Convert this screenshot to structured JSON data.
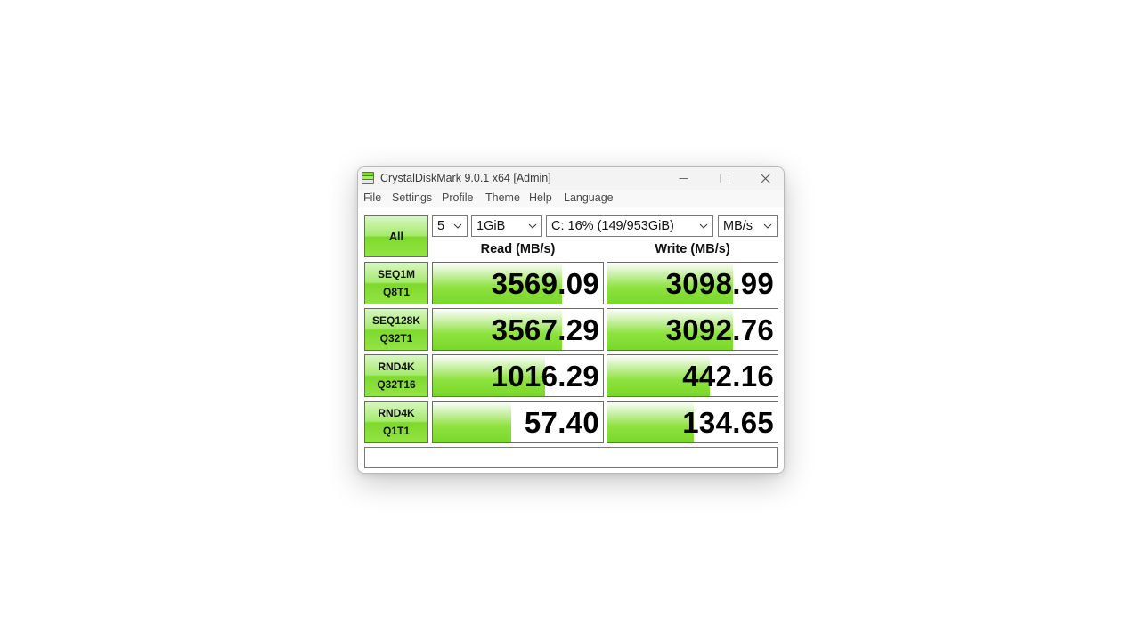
{
  "window": {
    "title": "CrystalDiskMark 9.0.1 x64 [Admin]"
  },
  "menu": [
    "File",
    "Settings",
    "Profile",
    "Theme",
    "Help",
    "Language"
  ],
  "controls": {
    "all_label": "All",
    "count": "5",
    "size": "1GiB",
    "drive": "C: 16% (149/953GiB)",
    "unit": "MB/s"
  },
  "headers": {
    "read": "Read (MB/s)",
    "write": "Write (MB/s)"
  },
  "rows": [
    {
      "line1": "SEQ1M",
      "line2": "Q8T1",
      "read": "3569.09",
      "write": "3098.99",
      "read_fill": 0.76,
      "write_fill": 0.74
    },
    {
      "line1": "SEQ128K",
      "line2": "Q32T1",
      "read": "3567.29",
      "write": "3092.76",
      "read_fill": 0.76,
      "write_fill": 0.74
    },
    {
      "line1": "RND4K",
      "line2": "Q32T16",
      "read": "1016.29",
      "write": "442.16",
      "read_fill": 0.66,
      "write_fill": 0.6
    },
    {
      "line1": "RND4K",
      "line2": "Q1T1",
      "read": "57.40",
      "write": "134.65",
      "read_fill": 0.46,
      "write_fill": 0.51
    }
  ],
  "comment": "",
  "colors": {
    "accent_green": "#79d82a",
    "border": "#6b6b6b"
  }
}
